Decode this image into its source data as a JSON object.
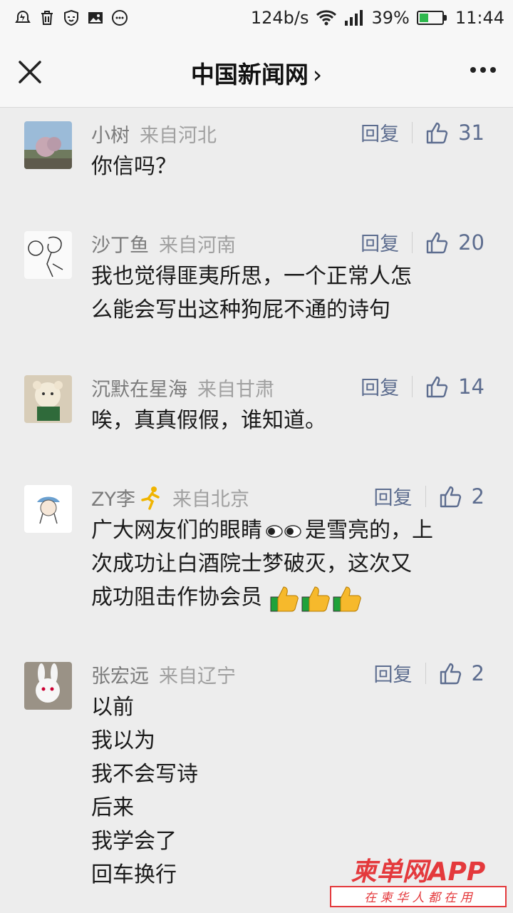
{
  "status_bar": {
    "speed": "124b/s",
    "battery_pct": "39%",
    "battery_level": 0.39,
    "time": "11:44"
  },
  "header": {
    "title": "中国新闻网",
    "chevron": "›",
    "close_icon": "close-icon",
    "more_icon": "more-icon"
  },
  "comments": [
    {
      "name": "小树",
      "location": "来自河北",
      "reply": "回复",
      "likes": "31",
      "lines": [
        "你信吗？"
      ]
    },
    {
      "name": "沙丁鱼",
      "location": "来自河南",
      "reply": "回复",
      "likes": "20",
      "lines": [
        "我也觉得匪夷所思，一个正常人怎",
        "么能会写出这种狗屁不通的诗句"
      ]
    },
    {
      "name": "沉默在星海",
      "location": "来自甘肃",
      "reply": "回复",
      "likes": "14",
      "lines": [
        "唉，真真假假，谁知道。"
      ]
    },
    {
      "name": "ZY李",
      "location": "来自北京",
      "reply": "回复",
      "likes": "2",
      "lines": [
        "广大网友们的眼睛",
        "是雪亮的，上",
        "次成功让白酒院士梦破灭，这次又",
        "成功阻击作协会员"
      ]
    },
    {
      "name": "张宏远",
      "location": "来自辽宁",
      "reply": "回复",
      "likes": "2",
      "lines": [
        "以前",
        "我以为",
        "我不会写诗",
        "后来",
        "我学会了",
        "回车换行"
      ]
    }
  ],
  "watermark": {
    "brand": "柬单网APP",
    "slogan": "在 柬 华 人 都 在 用",
    "color": "#e4393c"
  }
}
